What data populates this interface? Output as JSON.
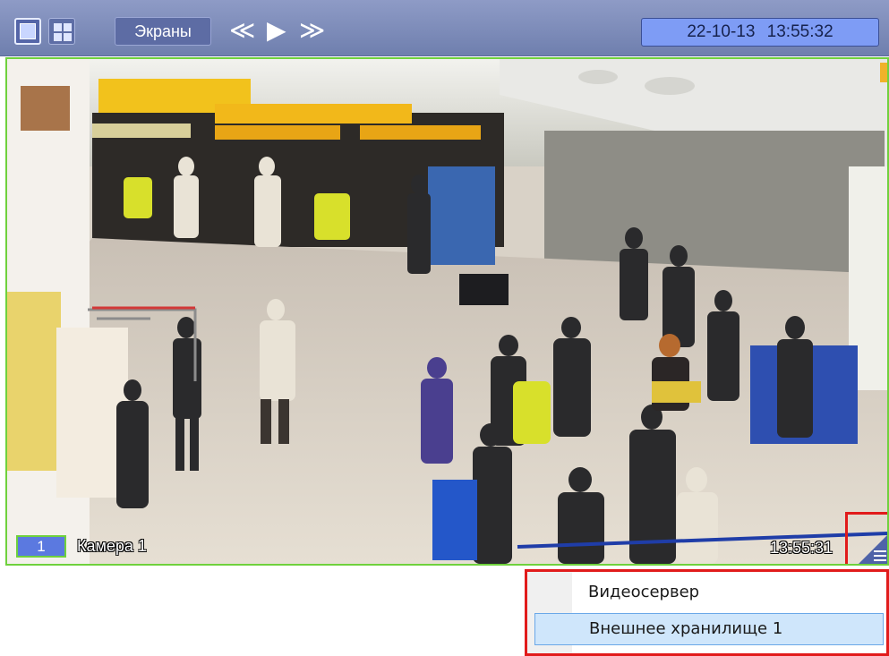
{
  "toolbar": {
    "screens_label": "Экраны",
    "nav_back": "≪",
    "nav_play": "▶",
    "nav_forward": "≫",
    "date": "22-10-13",
    "time": "13:55:32",
    "datetime": "22-10-13 13:55:32"
  },
  "camera": {
    "number": "1",
    "name": "Камера 1",
    "time": "13:55:31",
    "border_color": "#6fd13d"
  },
  "context_menu": {
    "items": [
      {
        "label": "Видеосервер",
        "selected": false
      },
      {
        "label": "Внешнее хранилище 1",
        "selected": true
      }
    ]
  },
  "colors": {
    "toolbar": "#7f8ebc",
    "accent": "#7e9cf5",
    "highlight": "#e11b1b"
  },
  "icons": [
    "single-view-icon",
    "grid-view-icon",
    "rewind-icon",
    "play-icon",
    "fast-forward-icon",
    "speaker-icon",
    "menu-icon"
  ]
}
